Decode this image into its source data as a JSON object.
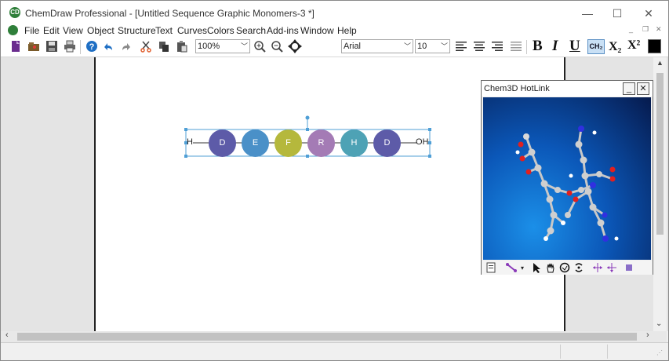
{
  "window": {
    "title": "ChemDraw Professional - [Untitled Sequence Graphic Monomers-3 *]",
    "app_icon": "chemdraw-logo-icon",
    "controls": {
      "minimize": "—",
      "maximize": "☐",
      "close": "✕"
    }
  },
  "menu": {
    "items": [
      "File",
      "Edit",
      "View",
      "Object",
      "Structure",
      "Text",
      "Curves",
      "Colors",
      "Search",
      "Add-ins",
      "Window",
      "Help"
    ],
    "mdi_controls": {
      "minimize": "_",
      "restore": "❐",
      "close": "✕"
    }
  },
  "toolbar": {
    "zoom_value": "100%",
    "font_value": "Arial",
    "font_size_value": "10",
    "bold_label": "B",
    "italic_label": "I",
    "underline_label": "U",
    "chem_label": "CH₂",
    "subscript_label": "X₂",
    "superscript_label": "X²"
  },
  "sequence": {
    "start_label": "H",
    "end_label": "OH",
    "monomers": [
      {
        "label": "D",
        "color": "#5d5ba8"
      },
      {
        "label": "E",
        "color": "#4a90c8"
      },
      {
        "label": "F",
        "color": "#b5b83c"
      },
      {
        "label": "R",
        "color": "#a47bb5"
      },
      {
        "label": "H",
        "color": "#4ea2b5"
      },
      {
        "label": "D",
        "color": "#5d5ba8"
      }
    ]
  },
  "hotlink": {
    "title": "Chem3D HotLink",
    "minimize_label": "_",
    "close_label": "✕"
  },
  "colors": {
    "selection": "#4f9fd6",
    "accent_purple": "#8a3ab9"
  }
}
